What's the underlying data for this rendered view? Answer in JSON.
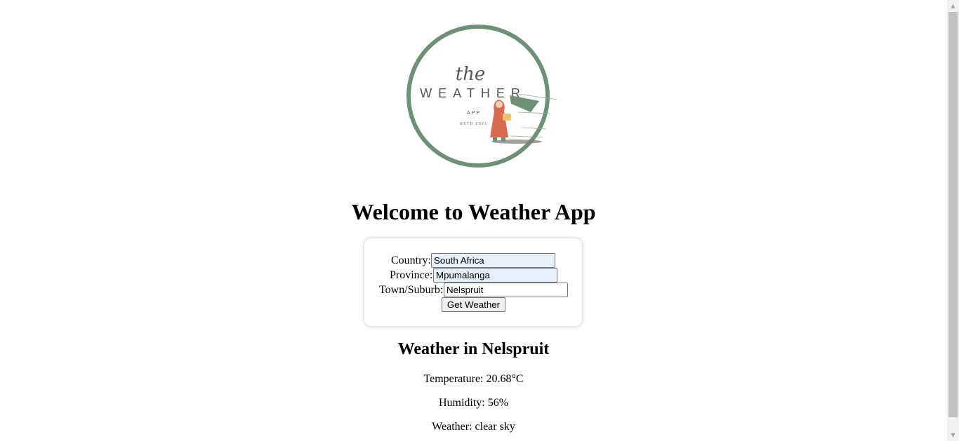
{
  "logo": {
    "word_the": "the",
    "word_main": "WEATHER",
    "word_app": "APP",
    "word_estd": "ESTD 2021",
    "ring_color": "#6e9176"
  },
  "page_title": "Welcome to Weather App",
  "form": {
    "country_label": "Country:",
    "country_value": "South Africa",
    "province_label": "Province:",
    "province_value": "Mpumalanga",
    "town_label": "Town/Suburb:",
    "town_value": "Nelspruit",
    "submit_label": "Get Weather"
  },
  "result": {
    "heading": "Weather in Nelspruit",
    "temperature": "Temperature: 20.68°C",
    "humidity": "Humidity: 56%",
    "weather": "Weather: clear sky"
  },
  "scrollbar": {
    "up_icon": "triangle-up",
    "down_icon": "triangle-down"
  }
}
